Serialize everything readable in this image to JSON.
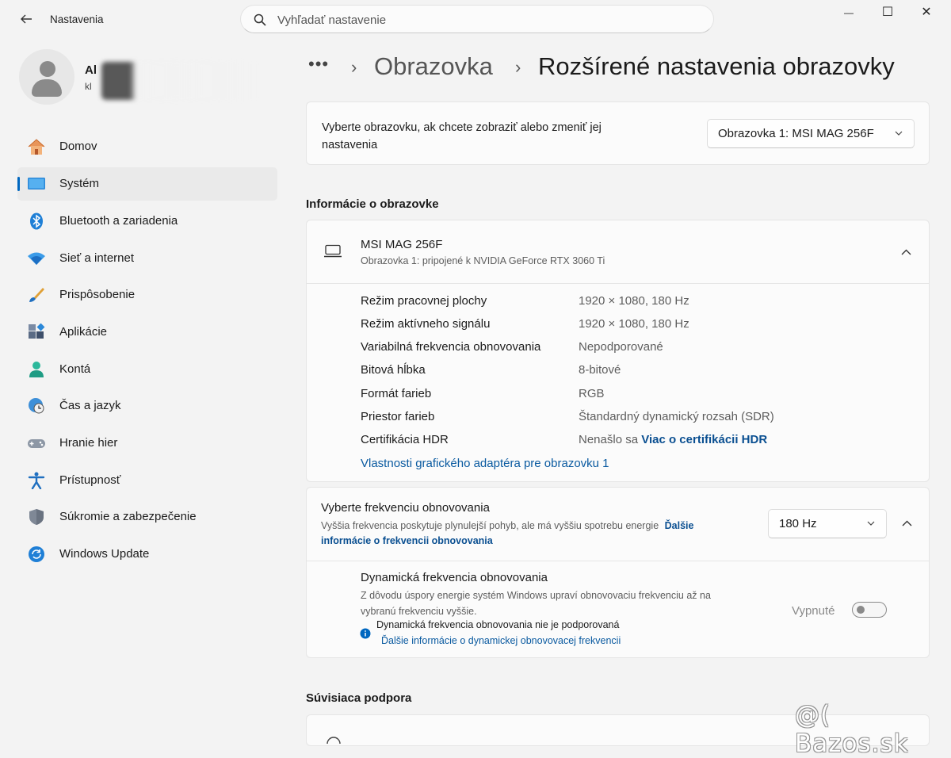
{
  "window": {
    "title": "Nastavenia",
    "minimize": "—",
    "maximize": "☐",
    "close": "✕"
  },
  "search": {
    "placeholder": "Vyhľadať nastavenie"
  },
  "profile": {
    "name": "Al",
    "email": "kl"
  },
  "sidebar": {
    "items": [
      {
        "label": "Domov",
        "icon": "home-icon"
      },
      {
        "label": "Systém",
        "icon": "monitor-icon",
        "active": true
      },
      {
        "label": "Bluetooth a zariadenia",
        "icon": "bluetooth-icon"
      },
      {
        "label": "Sieť a internet",
        "icon": "wifi-icon"
      },
      {
        "label": "Prispôsobenie",
        "icon": "brush-icon"
      },
      {
        "label": "Aplikácie",
        "icon": "apps-icon"
      },
      {
        "label": "Kontá",
        "icon": "account-icon"
      },
      {
        "label": "Čas a jazyk",
        "icon": "clock-globe-icon"
      },
      {
        "label": "Hranie hier",
        "icon": "gamepad-icon"
      },
      {
        "label": "Prístupnosť",
        "icon": "accessibility-icon"
      },
      {
        "label": "Súkromie a zabezpečenie",
        "icon": "shield-icon"
      },
      {
        "label": "Windows Update",
        "icon": "update-icon"
      }
    ]
  },
  "breadcrumb": {
    "more": "•••",
    "sep": "›",
    "parent": "Obrazovka",
    "current": "Rozšírené nastavenia obrazovky"
  },
  "select_display": {
    "label_line1": "Vyberte obrazovku, ak chcete zobraziť alebo zmeniť jej",
    "label_line2": "nastavenia",
    "value": "Obrazovka 1: MSI MAG 256F"
  },
  "display_info": {
    "heading": "Informácie o obrazovke",
    "monitor_name": "MSI MAG 256F",
    "monitor_sub": "Obrazovka 1: pripojené k NVIDIA GeForce RTX 3060 Ti",
    "rows": [
      {
        "key": "Režim pracovnej plochy",
        "value": "1920 × 1080, 180 Hz"
      },
      {
        "key": "Režim aktívneho signálu",
        "value": "1920 × 1080, 180 Hz"
      },
      {
        "key": "Variabilná frekvencia obnovovania",
        "value": "Nepodporované"
      },
      {
        "key": "Bitová hĺbka",
        "value": "8-bitové"
      },
      {
        "key": "Formát farieb",
        "value": "RGB"
      },
      {
        "key": "Priestor farieb",
        "value": "Štandardný dynamický rozsah (SDR)"
      },
      {
        "key": "Certifikácia HDR",
        "value": "Nenašlo sa"
      }
    ],
    "hdr_link": "Viac o certifikácii HDR",
    "adapter_link": "Vlastnosti grafického adaptéra pre obrazovku 1"
  },
  "refresh": {
    "title": "Vyberte frekvenciu obnovovania",
    "desc": "Vyššia frekvencia poskytuje plynulejší pohyb, ale má vyššiu spotrebu energie",
    "link_part1": "Ďalšie",
    "link_part2": "informácie o frekvencii obnovovania",
    "value": "180 Hz"
  },
  "dynamic_refresh": {
    "title": "Dynamická frekvencia obnovovania",
    "desc_line1": "Z dôvodu úspory energie systém Windows upraví obnovovaciu frekvenciu až na",
    "desc_line2": "vybranú frekvenciu vyššie.",
    "state": "Vypnuté",
    "note": "Dynamická frekvencia obnovovania nie je podporovaná",
    "note_link": "Ďalšie informácie o dynamickej obnovovacej frekvencii"
  },
  "related": {
    "heading": "Súvisiaca podpora"
  },
  "watermark": "@( Bazos.sk",
  "colors": {
    "accent": "#0067c0",
    "link": "#0a5aa0",
    "background": "#f3f3f3"
  }
}
